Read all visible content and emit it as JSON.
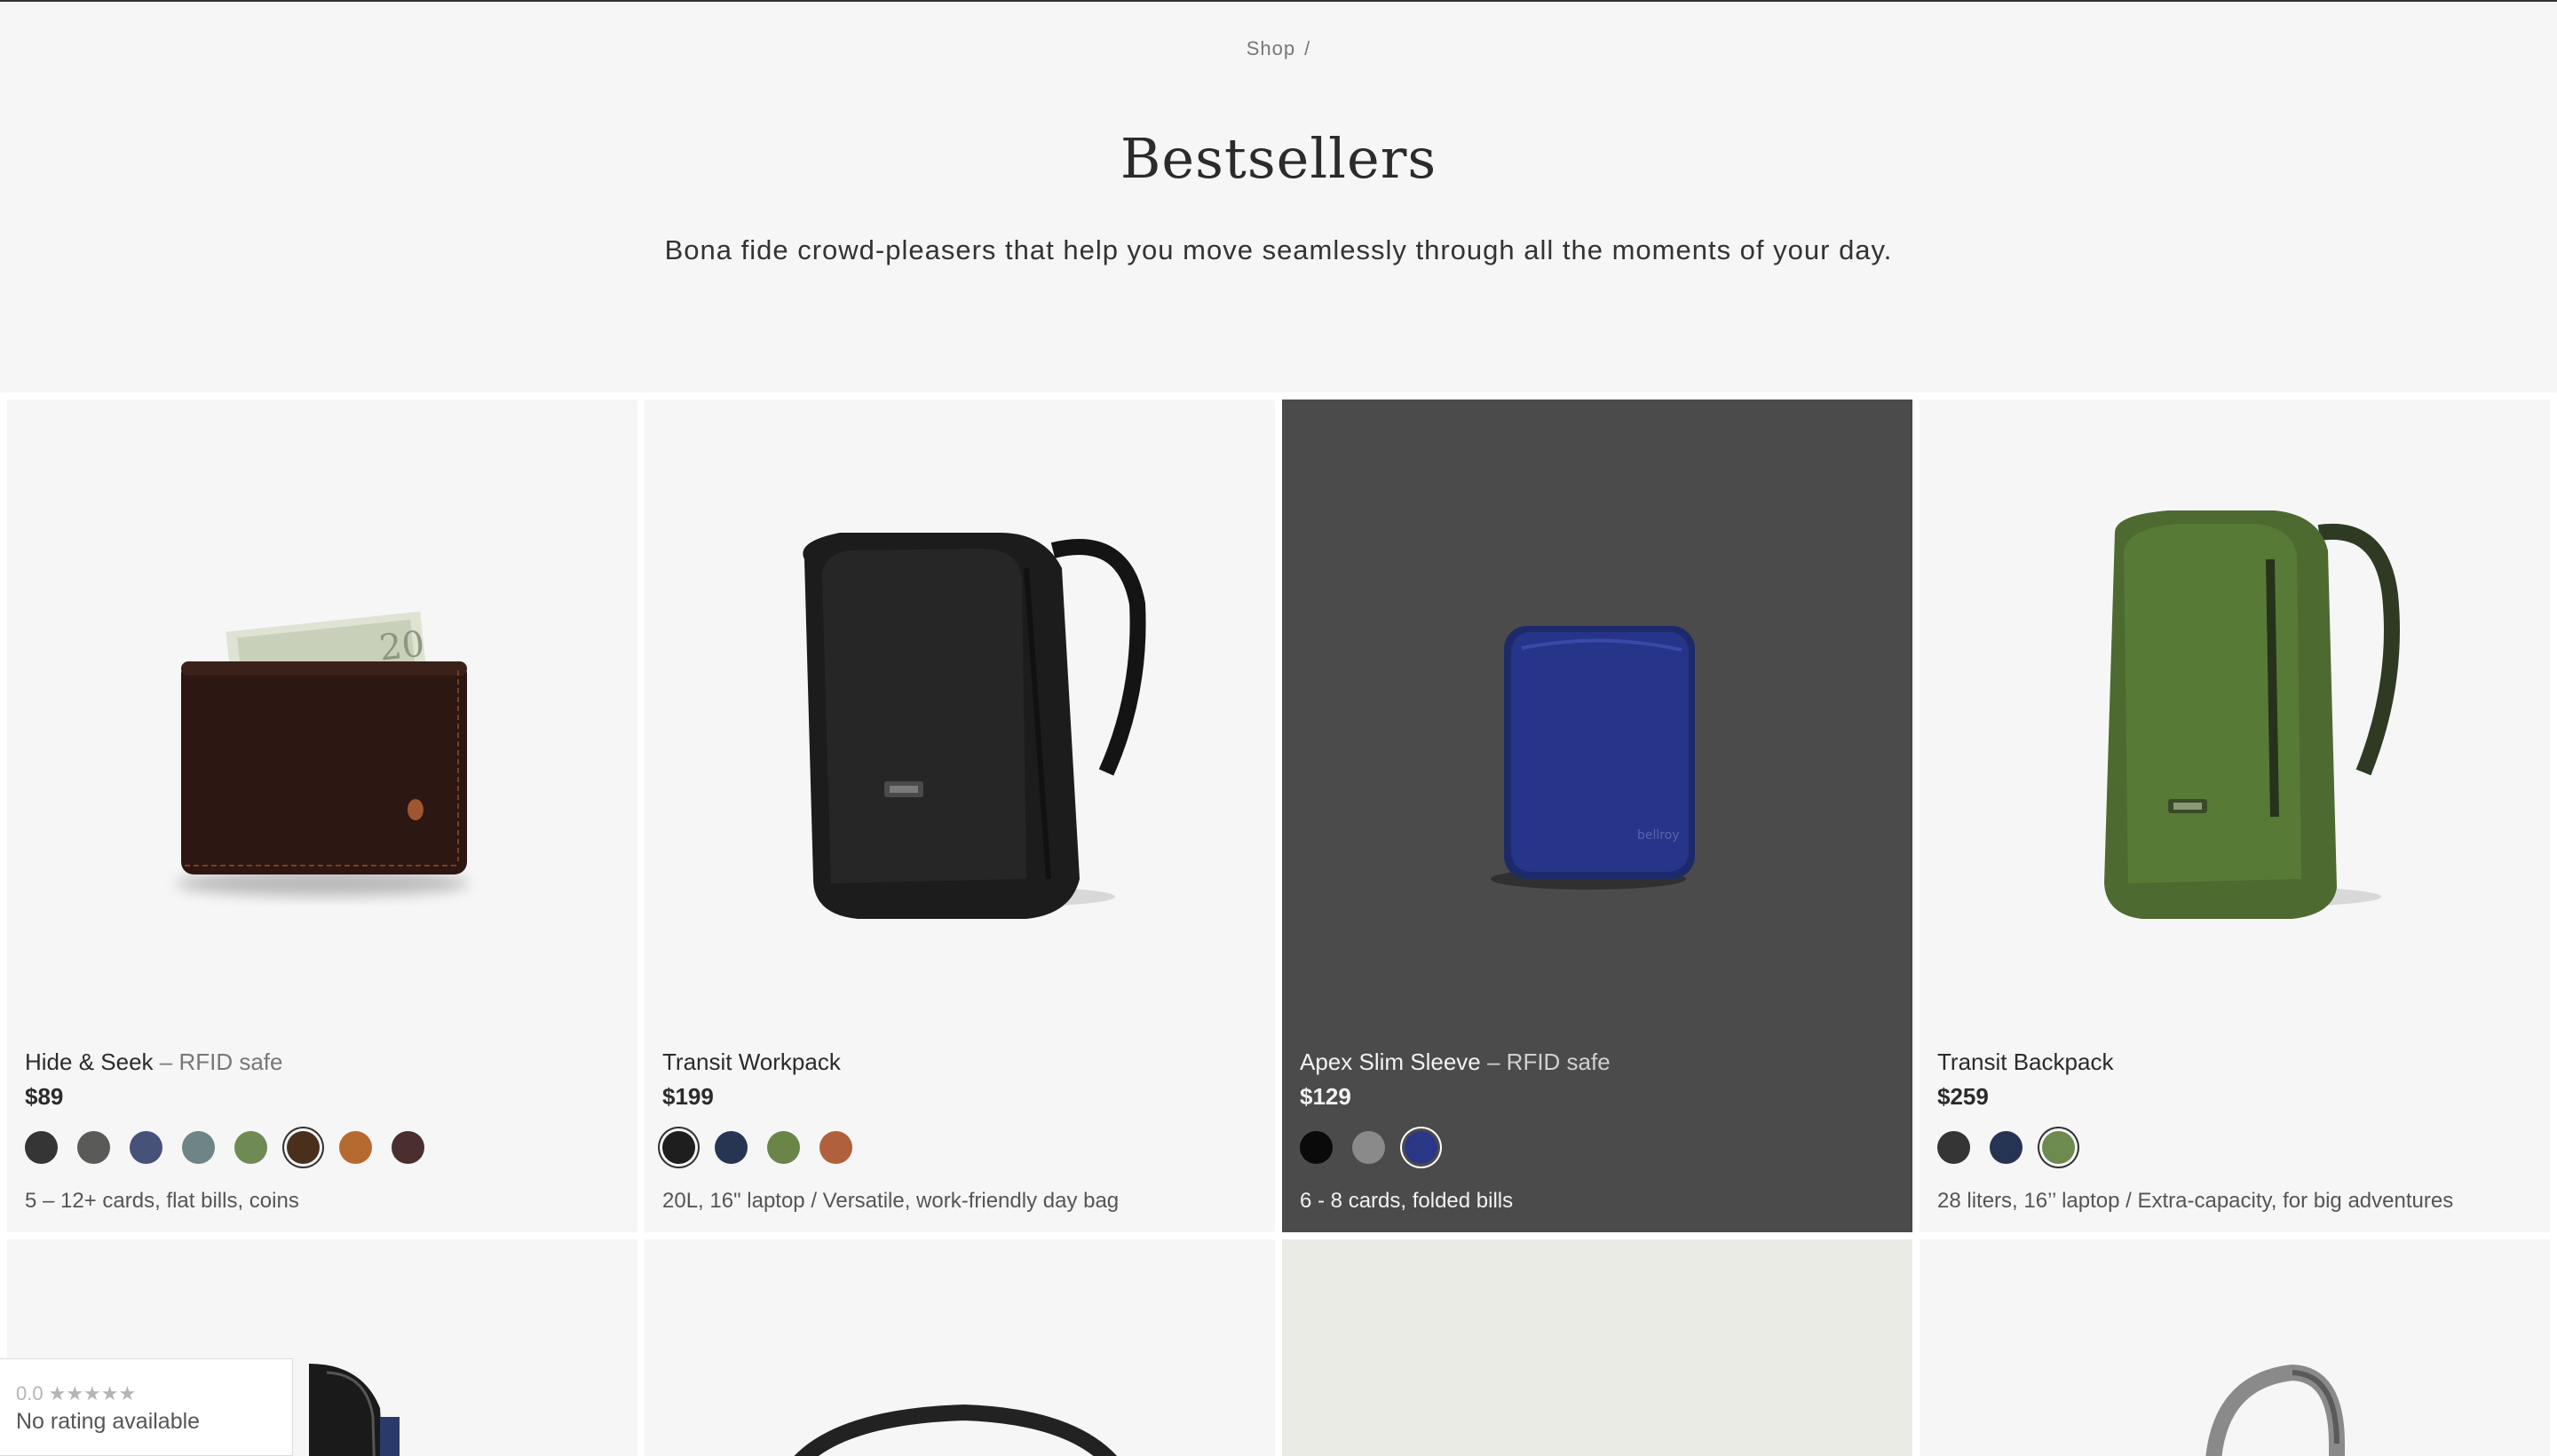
{
  "breadcrumb": {
    "shop": "Shop",
    "separator": "/"
  },
  "header": {
    "title": "Bestsellers",
    "subtitle": "Bona fide crowd-pleasers that help you move seamlessly through all the moments of your day."
  },
  "products": [
    {
      "name": "Hide & Seek",
      "tag": " – RFID safe",
      "price": "$89",
      "description": "5 – 12+ cards, flat bills, coins",
      "swatches": [
        "#353535",
        "#5a5a58",
        "#46527a",
        "#6e8486",
        "#6f8a52",
        "#4a2f1c",
        "#b76a30",
        "#4b2f30"
      ],
      "selected_swatch": 5
    },
    {
      "name": "Transit Workpack",
      "tag": "",
      "price": "$199",
      "description": "20L, 16\" laptop / Versatile, work-friendly day bag",
      "swatches": [
        "#1e1e1e",
        "#273552",
        "#6b8448",
        "#b0603a"
      ],
      "selected_swatch": 0
    },
    {
      "name": "Apex Slim Sleeve",
      "tag": " – RFID safe",
      "price": "$129",
      "description": "6 - 8 cards, folded bills",
      "swatches": [
        "#0a0a0a",
        "#8a8a8a",
        "#2a3787"
      ],
      "selected_swatch": 2
    },
    {
      "name": "Transit Backpack",
      "tag": "",
      "price": "$259",
      "description": "28 liters, 16’’ laptop / Extra-capacity, for big adventures",
      "swatches": [
        "#353535",
        "#263454",
        "#6d8a4f"
      ],
      "selected_swatch": 2
    }
  ],
  "rating_widget": {
    "score": "0.0",
    "stars": "★★★★★",
    "text": "No rating available"
  }
}
